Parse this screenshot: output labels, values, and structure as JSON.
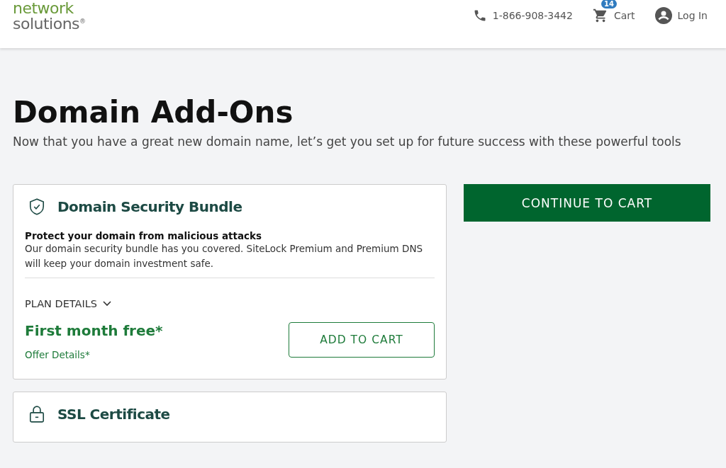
{
  "header": {
    "logo": {
      "line1": "network",
      "line2": "solutions$^{®}$"
    },
    "phone": "1-866-908-3442",
    "cart": {
      "label": "Cart",
      "count": "14"
    },
    "login": "Log In"
  },
  "page": {
    "title": "Domain Add-Ons",
    "subtitle": "Now that you have a great new domain name, let’s get you set up for future success with these powerful tools"
  },
  "products": [
    {
      "kind": "shield",
      "title": "Domain Security Bundle",
      "headline": "Protect your domain from malicious attacks",
      "description": "Our domain security bundle has you covered. SiteLock Premium and Premium DNS will keep your domain investment safe.",
      "plan_details": {
        "label": "PLAN DETAILS",
        "expanded": false
      },
      "price": "First month free*",
      "offer_link": "Offer Details*",
      "button": "ADD TO CART"
    },
    {
      "kind": "lock",
      "title": "SSL Certificate"
    }
  ],
  "continue_button": "CONTINUE TO CART"
}
